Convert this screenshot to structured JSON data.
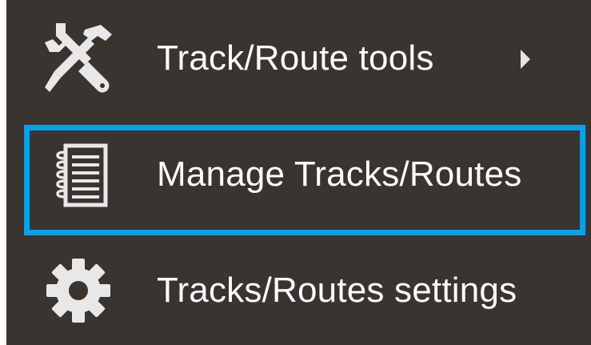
{
  "menu": {
    "items": [
      {
        "label": "Track/Route tools",
        "icon": "tools-icon",
        "has_submenu": true
      },
      {
        "label": "Manage Tracks/Routes",
        "icon": "notebook-icon",
        "highlighted": true
      },
      {
        "label": "Tracks/Routes settings",
        "icon": "gear-icon"
      }
    ]
  },
  "colors": {
    "menu_background": "#3a3430",
    "text": "#ffffff",
    "icon": "#e8e8e8",
    "highlight": "#00a2e8"
  }
}
